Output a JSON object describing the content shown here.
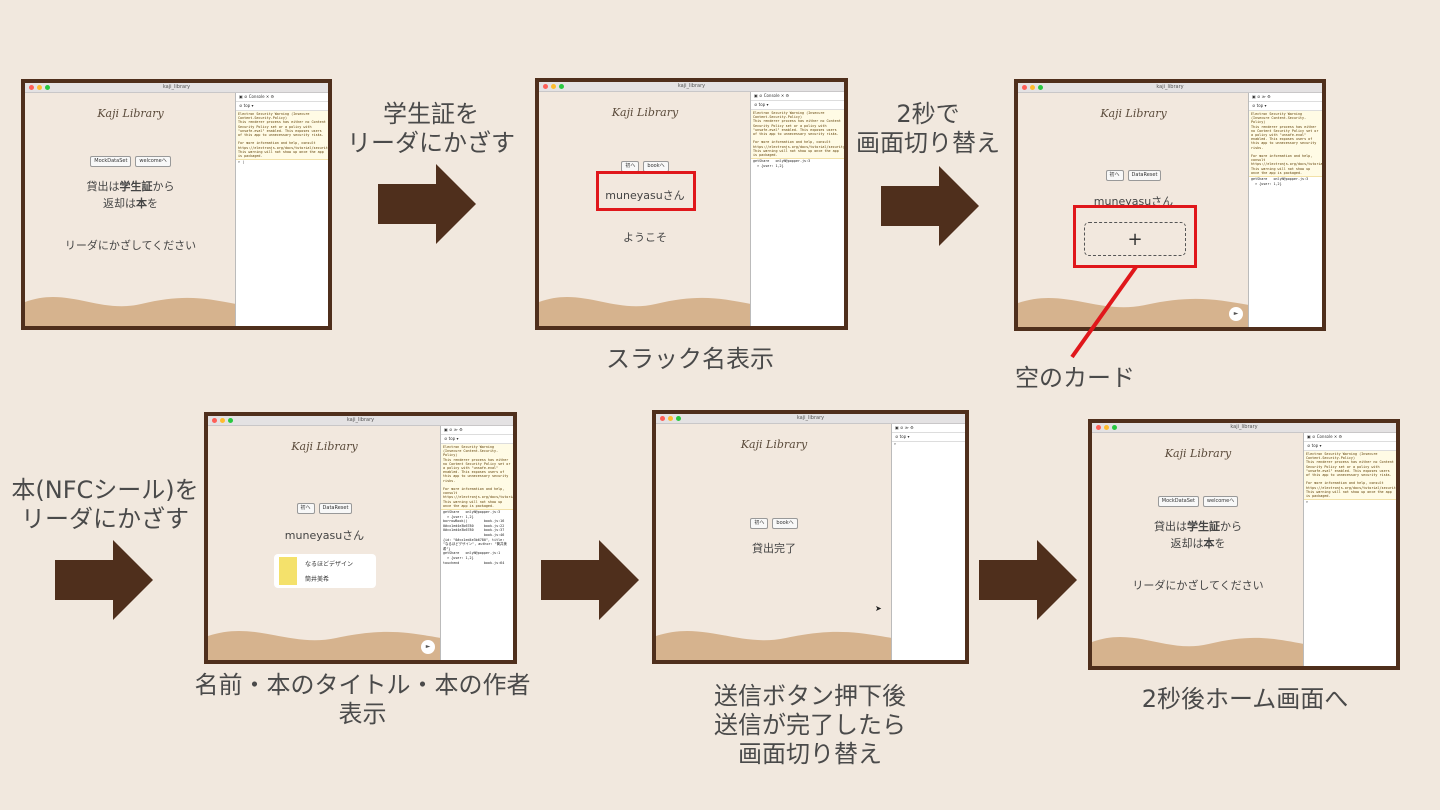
{
  "colors": {
    "frame": "#4f2f1c",
    "arrow": "#4f2f1c",
    "highlight": "#e0171b",
    "background": "#f1e8de",
    "wave": "#d6b38e",
    "app_bg": "#f2e8de"
  },
  "window_title": "kaji_library",
  "logo_text": "Kaji Library",
  "devtools": {
    "tab_console": "Console",
    "context": "top",
    "warning_text": "Electron Security Warning (Insecure Content-Security-Policy)\nThis renderer process has either no Content Security Policy set or a policy with \"unsafe-eval\" enabled. This exposes users of this app to unnecessary security risks.\n\nFor more information and help, consult https://electronjs.org/docs/tutorial/security.\nThis warning will not show up once the app is packaged.",
    "log_ref": "electron/js2c/renderer_init.js:11",
    "log_short": "getShare   onlyN@popper.js:3\n  > {user: 1,2}",
    "log_long": "getShare   onlyN@popper.js:3\n  > {user: 1,2}\nborrowBook()        book.js:16\n0#cx1ed4e3b6780     book.js:22\n0#cx1ed4e3b6780     book.js:37\n                    book.js:46\n{id: \"0#cx1ed4e3b6780\", title: \"なるほどデザイン\", author: \"筒井美希\"}\ngetShare   onlyN@popper.js:1\n  > {user: 1,2}\ntouchend            book.js:64"
  },
  "screens": {
    "s1": {
      "btn1": "MockDataSet",
      "btn2": "welcomeへ",
      "line1_a": "貸出は",
      "line1_b": "学生証",
      "line1_c": "から",
      "line2_a": "返却は",
      "line2_b": "本",
      "line2_c": "を",
      "prompt": "リーダにかざしてください"
    },
    "s2": {
      "btn1": "初へ",
      "btn2": "bookへ",
      "name": "muneyasuさん",
      "welcome": "ようこそ"
    },
    "s3": {
      "btn1": "初へ",
      "btn2": "DataReset",
      "name": "muneyasuさん",
      "plus": "+",
      "play": "►"
    },
    "s4": {
      "btn1": "初へ",
      "btn2": "DataReset",
      "name": "muneyasuさん",
      "book_title": "なるほどデザイン",
      "book_author": "筒井美希",
      "play": "►"
    },
    "s5": {
      "btn1": "初へ",
      "btn2": "bookへ",
      "status": "貸出完了"
    },
    "s6": {
      "btn1": "MockDataSet",
      "btn2": "welcomeへ",
      "line1_a": "貸出は",
      "line1_b": "学生証",
      "line1_c": "から",
      "line2_a": "返却は",
      "line2_b": "本",
      "line2_c": "を",
      "prompt": "リーダにかざしてください"
    }
  },
  "captions": {
    "arrow1": "学生証を\nリーダにかざす",
    "arrow2": "2秒で\n画面切り替え",
    "screen2": "スラック名表示",
    "empty_card": "空のカード",
    "arrow3": "本(NFCシール)を\nリーダにかざす",
    "screen4": "名前・本のタイトル・本の作者\n表示",
    "screen5": "送信ボタン押下後\n送信が完了したら\n画面切り替え",
    "screen6": "2秒後ホーム画面へ"
  }
}
